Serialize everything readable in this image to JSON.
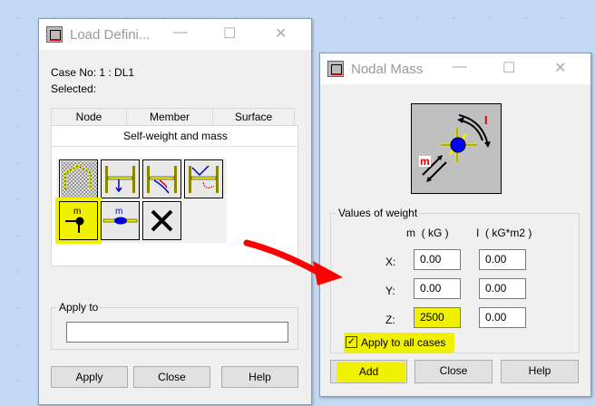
{
  "load_dialog": {
    "title": "Load Defini...",
    "case_label": "Case No: 1 : DL1",
    "selected_label": "Selected:",
    "tabs": [
      "Node",
      "Member",
      "Surface"
    ],
    "active_subtab": "Self-weight and mass",
    "tool_icons": [
      "self-weight",
      "member-load",
      "member-deflection",
      "member-dynamic",
      "nodal-mass",
      "member-mass",
      "delete"
    ],
    "apply_to_label": "Apply to",
    "apply_to_value": "",
    "buttons": {
      "apply": "Apply",
      "close": "Close",
      "help": "Help"
    }
  },
  "nodal_mass_dialog": {
    "title": "Nodal Mass",
    "diagram": {
      "m_label": "m",
      "i_label": "I"
    },
    "group_label": "Values of weight",
    "col_m": "m  ( kG )",
    "col_i": "I  ( kG*m2 )",
    "rows": [
      {
        "label": "X:",
        "m": "0.00",
        "i": "0.00"
      },
      {
        "label": "Y:",
        "m": "0.00",
        "i": "0.00"
      },
      {
        "label": "Z:",
        "m": "2500",
        "i": "0.00"
      }
    ],
    "apply_all_label": "Apply to all cases",
    "apply_all_checked": true,
    "buttons": {
      "add": "Add",
      "close": "Close",
      "help": "Help"
    }
  },
  "colors": {
    "highlight": "#f0f000",
    "annotation_arrow": "#ff0000"
  }
}
